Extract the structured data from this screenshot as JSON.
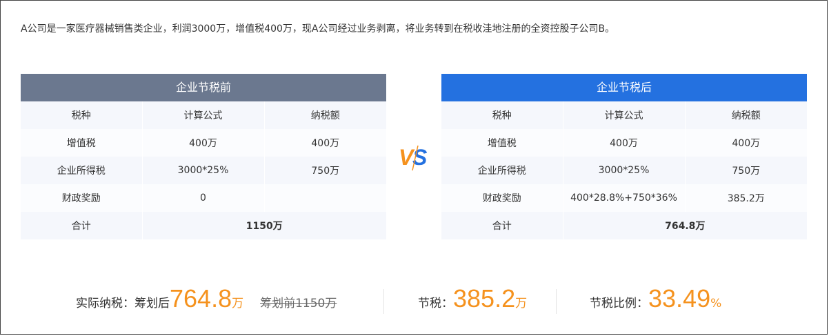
{
  "intro": "A公司是一家医疗器械销售类企业，利润3000万，增值税400万，现A公司经过业务剥离，将业务转到在税收洼地注册的全资控股子公司B。",
  "before": {
    "title": "企业节税前",
    "headers": [
      "税种",
      "计算公式",
      "纳税额"
    ],
    "rows": [
      [
        "增值税",
        "400万",
        "400万"
      ],
      [
        "企业所得税",
        "3000*25%",
        "750万"
      ],
      [
        "财政奖励",
        "0",
        ""
      ]
    ],
    "total_label": "合计",
    "total_value": "1150万"
  },
  "after": {
    "title": "企业节税后",
    "headers": [
      "税种",
      "计算公式",
      "纳税额"
    ],
    "rows": [
      [
        "增值税",
        "400万",
        "400万"
      ],
      [
        "企业所得税",
        "3000*25%",
        "750万"
      ],
      [
        "财政奖励",
        "400*28.8%+750*36%",
        "385.2万"
      ]
    ],
    "total_label": "合计",
    "total_value": "764.8万"
  },
  "vs_label": "VS",
  "summary": {
    "actual_label": "实际纳税：筹划后",
    "actual_value": "764.8",
    "actual_unit": "万",
    "before_strike": "筹划前1150万",
    "save_label": "节税：",
    "save_value": "385.2",
    "save_unit": "万",
    "ratio_label": "节税比例：",
    "ratio_value": "33.49",
    "ratio_unit": "%"
  },
  "colors": {
    "before_header": "#6b788f",
    "after_header": "#2471e0",
    "accent_orange": "#f5921e",
    "vs_blue": "#2471e0"
  }
}
